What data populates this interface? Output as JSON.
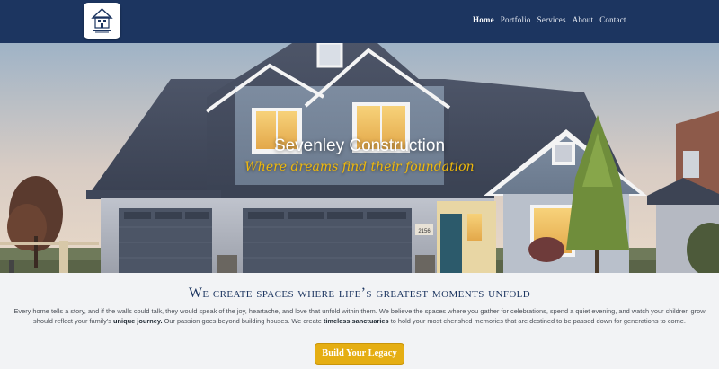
{
  "nav": {
    "logo_icon": "house-logo-icon",
    "links": [
      {
        "label": "Home",
        "active": true
      },
      {
        "label": "Portfolio",
        "active": false
      },
      {
        "label": "Services",
        "active": false
      },
      {
        "label": "About",
        "active": false
      },
      {
        "label": "Contact",
        "active": false
      }
    ]
  },
  "hero": {
    "title": "Sevenley Construction",
    "subtitle": "Where dreams find their foundation",
    "house_number": "2156"
  },
  "content": {
    "headline": "We create spaces where life’s greatest moments unfold",
    "para_1": "Every home tells a story, and if the walls could talk, they would speak of the joy, heartache, and love that unfold within them. We believe the spaces where you gather for celebrations, spend a quiet evening, and watch your children grow should reflect your family’s ",
    "para_bold_1": "unique journey.",
    "para_2": " Our passion goes beyond building houses. We create ",
    "para_bold_2": "timeless sanctuaries",
    "para_3": " to hold your most cherished memories that are destined to be passed down for generations to come.",
    "cta_label": "Build Your Legacy"
  },
  "colors": {
    "navy": "#1c3560",
    "gold": "#e5ae13",
    "subtitle_gold": "#f0b90b"
  }
}
